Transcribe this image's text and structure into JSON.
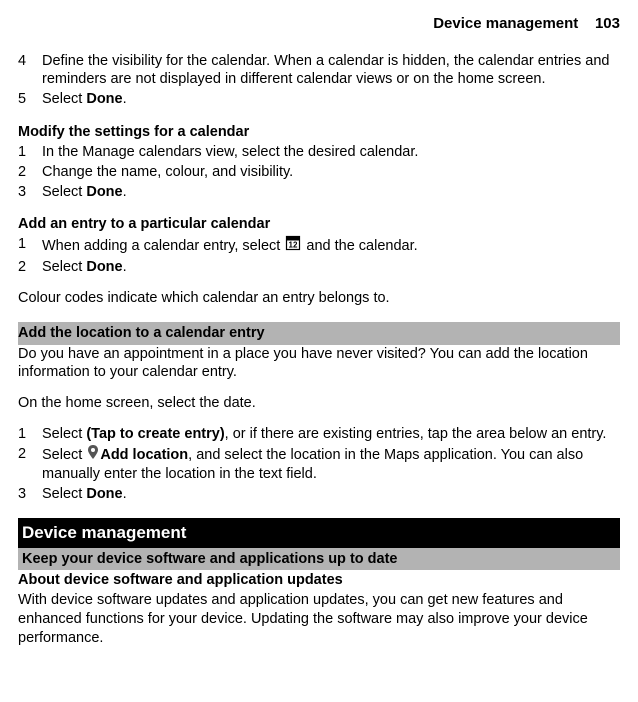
{
  "header": {
    "title": "Device management",
    "page": "103"
  },
  "block1": {
    "items": [
      {
        "n": "4",
        "pre": "Define the visibility for the calendar. When a calendar is hidden, the calendar entries and reminders are not displayed in different calendar views or on the home screen."
      },
      {
        "n": "5",
        "pre": "Select ",
        "bold": "Done",
        "post": "."
      }
    ]
  },
  "block2": {
    "heading": "Modify the settings for a calendar",
    "items": [
      {
        "n": "1",
        "pre": "In the Manage calendars view, select the desired calendar."
      },
      {
        "n": "2",
        "pre": "Change the name, colour, and visibility."
      },
      {
        "n": "3",
        "pre": "Select ",
        "bold": "Done",
        "post": "."
      }
    ]
  },
  "block3": {
    "heading": "Add an entry to a particular calendar",
    "items": [
      {
        "n": "1",
        "pre": "When adding a calendar entry, select ",
        "icon": "calendar",
        "post": " and the calendar."
      },
      {
        "n": "2",
        "pre": "Select ",
        "bold": "Done",
        "post": "."
      }
    ],
    "para": "Colour codes indicate which calendar an entry belongs to."
  },
  "block4": {
    "band": "Add the location to a calendar entry",
    "p1": "Do you have an appointment in a place you have never visited? You can add the location information to your calendar entry.",
    "p2": "On the home screen, select the date.",
    "items": [
      {
        "n": "1",
        "pre": "Select ",
        "bold": "(Tap to create entry)",
        "post": ", or if there are existing entries, tap the area below an entry."
      },
      {
        "n": "2",
        "pre": "Select ",
        "icon": "pin",
        "bold": "Add location",
        "post": ", and select the location in the Maps application. You can also manually enter the location in the text field."
      },
      {
        "n": "3",
        "pre": "Select ",
        "bold": "Done",
        "post": "."
      }
    ]
  },
  "block5": {
    "blackband": "Device management",
    "grayband": "Keep your device software and applications up to date",
    "subheading": "About device software and application updates",
    "para": "With device software updates and application updates, you can get new features and enhanced functions for your device. Updating the software may also improve your device performance."
  }
}
